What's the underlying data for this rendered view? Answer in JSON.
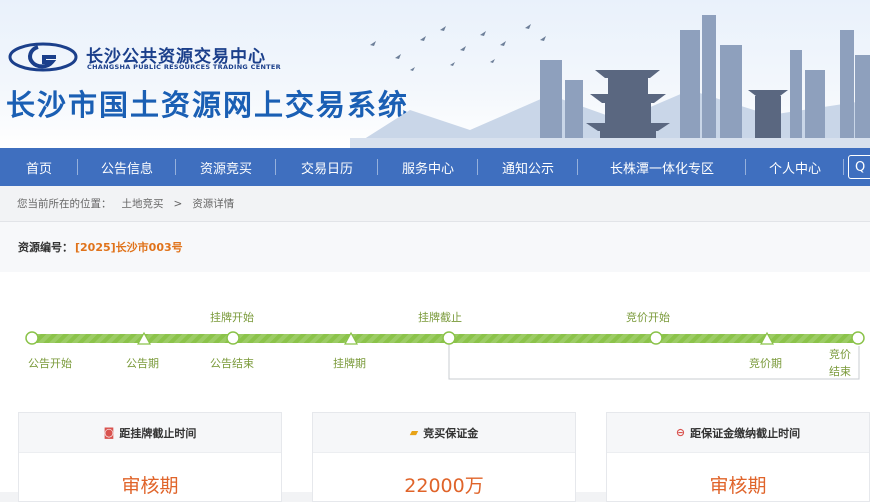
{
  "header": {
    "org_name": "长沙公共资源交易中心",
    "org_en": "CHANGSHA PUBLIC RESOURCES TRADING CENTER",
    "system_title": "长沙市国土资源网上交易系统"
  },
  "nav": {
    "items": [
      "首页",
      "公告信息",
      "资源竞买",
      "交易日历",
      "服务中心",
      "通知公示",
      "长株潭一体化专区",
      "个人中心"
    ],
    "search_glyph": "Q"
  },
  "breadcrumb": {
    "prefix": "您当前所在的位置：",
    "items": [
      "土地竞买",
      "资源详情"
    ],
    "separator": ">"
  },
  "resource": {
    "label": "资源编号：",
    "value": "[2025]长沙市003号"
  },
  "timeline": {
    "top_labels": [
      "挂牌开始",
      "挂牌截止",
      "竞价开始"
    ],
    "bottom_labels": [
      "公告开始",
      "公告期",
      "公告结束",
      "挂牌期",
      "竞价期"
    ],
    "end_label_1": "竞价",
    "end_label_2": "结束"
  },
  "cards": [
    {
      "title": "距挂牌截止时间",
      "value": "审核期",
      "icon": "clock-icon"
    },
    {
      "title": "竞买保证金",
      "value": "22000万",
      "icon": "money-icon"
    },
    {
      "title": "距保证金缴纳截止时间",
      "value": "审核期",
      "icon": "timer-icon"
    }
  ],
  "colors": {
    "nav_bg": "#3f6fbf",
    "title_blue": "#1a5fb4",
    "accent_orange": "#e0731b",
    "timeline_green": "#7cb342"
  }
}
